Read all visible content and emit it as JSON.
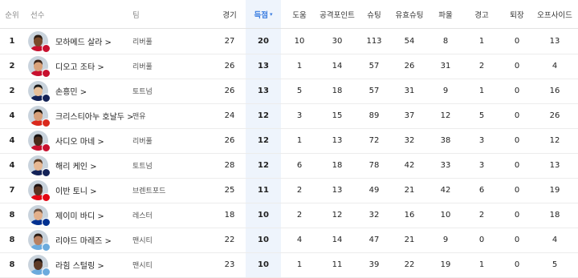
{
  "headers": {
    "rank": "순위",
    "player": "선수",
    "team": "팀",
    "games": "경기",
    "goals": "득점",
    "goals_sort": "▾",
    "assists": "도움",
    "points": "공격포인트",
    "shots": "슈팅",
    "on_target": "유효슈팅",
    "fouls": "파울",
    "yellow": "경고",
    "red": "퇴장",
    "offside": "오프사이드"
  },
  "colors": {
    "accent": "#3a7de0",
    "highlight_column": "#eef4fc",
    "liverpool": "#c8102e",
    "tottenham": "#132257",
    "manutd": "#da291c",
    "brentford": "#e30613",
    "leicester": "#003090",
    "mancity": "#6cabdd"
  },
  "rows": [
    {
      "rank": "1",
      "name": "모하메드 살라 >",
      "team": "리버풀",
      "games": "27",
      "goals": "20",
      "assists": "10",
      "points": "30",
      "shots": "113",
      "on_target": "54",
      "fouls": "8",
      "yellow": "1",
      "red": "0",
      "offside": "13",
      "skin": "#7a4a2a",
      "hair": "#2a1a10",
      "badge": "#c8102e"
    },
    {
      "rank": "2",
      "name": "디오고 조타 >",
      "team": "리버풀",
      "games": "26",
      "goals": "13",
      "assists": "1",
      "points": "14",
      "shots": "57",
      "on_target": "26",
      "fouls": "31",
      "yellow": "2",
      "red": "0",
      "offside": "4",
      "skin": "#d9a27a",
      "hair": "#3a2418",
      "badge": "#c8102e"
    },
    {
      "rank": "2",
      "name": "손흥민 >",
      "team": "토트넘",
      "games": "26",
      "goals": "13",
      "assists": "5",
      "points": "18",
      "shots": "57",
      "on_target": "31",
      "fouls": "9",
      "yellow": "1",
      "red": "0",
      "offside": "16",
      "skin": "#e8c09a",
      "hair": "#1a1a1a",
      "badge": "#132257"
    },
    {
      "rank": "4",
      "name": "크리스티아누 호날두 >",
      "team": "맨유",
      "games": "24",
      "goals": "12",
      "assists": "3",
      "points": "15",
      "shots": "89",
      "on_target": "37",
      "fouls": "12",
      "yellow": "5",
      "red": "0",
      "offside": "26",
      "skin": "#d7a07a",
      "hair": "#1a1208",
      "badge": "#da291c"
    },
    {
      "rank": "4",
      "name": "사디오 마네 >",
      "team": "리버풀",
      "games": "26",
      "goals": "12",
      "assists": "1",
      "points": "13",
      "shots": "72",
      "on_target": "32",
      "fouls": "38",
      "yellow": "3",
      "red": "0",
      "offside": "12",
      "skin": "#4a2c1c",
      "hair": "#151010",
      "badge": "#c8102e"
    },
    {
      "rank": "4",
      "name": "해리 케인 >",
      "team": "토트넘",
      "games": "28",
      "goals": "12",
      "assists": "6",
      "points": "18",
      "shots": "78",
      "on_target": "42",
      "fouls": "33",
      "yellow": "3",
      "red": "0",
      "offside": "13",
      "skin": "#e6b894",
      "hair": "#5a3a22",
      "badge": "#132257"
    },
    {
      "rank": "7",
      "name": "이반 토니 >",
      "team": "브렌트포드",
      "games": "25",
      "goals": "11",
      "assists": "2",
      "points": "13",
      "shots": "49",
      "on_target": "21",
      "fouls": "42",
      "yellow": "6",
      "red": "0",
      "offside": "19",
      "skin": "#5a3422",
      "hair": "#1a1010",
      "badge": "#e30613"
    },
    {
      "rank": "8",
      "name": "제이미 바디 >",
      "team": "레스터",
      "games": "18",
      "goals": "10",
      "assists": "2",
      "points": "12",
      "shots": "32",
      "on_target": "16",
      "fouls": "10",
      "yellow": "2",
      "red": "0",
      "offside": "18",
      "skin": "#e2b08c",
      "hair": "#6a5040",
      "badge": "#003090"
    },
    {
      "rank": "8",
      "name": "리야드 마레즈 >",
      "team": "맨시티",
      "games": "22",
      "goals": "10",
      "assists": "4",
      "points": "14",
      "shots": "47",
      "on_target": "21",
      "fouls": "9",
      "yellow": "0",
      "red": "0",
      "offside": "4",
      "skin": "#b88060",
      "hair": "#2a1c14",
      "badge": "#6cabdd"
    },
    {
      "rank": "8",
      "name": "라힘 스털링 >",
      "team": "맨시티",
      "games": "23",
      "goals": "10",
      "assists": "1",
      "points": "11",
      "shots": "39",
      "on_target": "22",
      "fouls": "19",
      "yellow": "1",
      "red": "0",
      "offside": "5",
      "skin": "#5c3a26",
      "hair": "#141010",
      "badge": "#6cabdd"
    }
  ]
}
